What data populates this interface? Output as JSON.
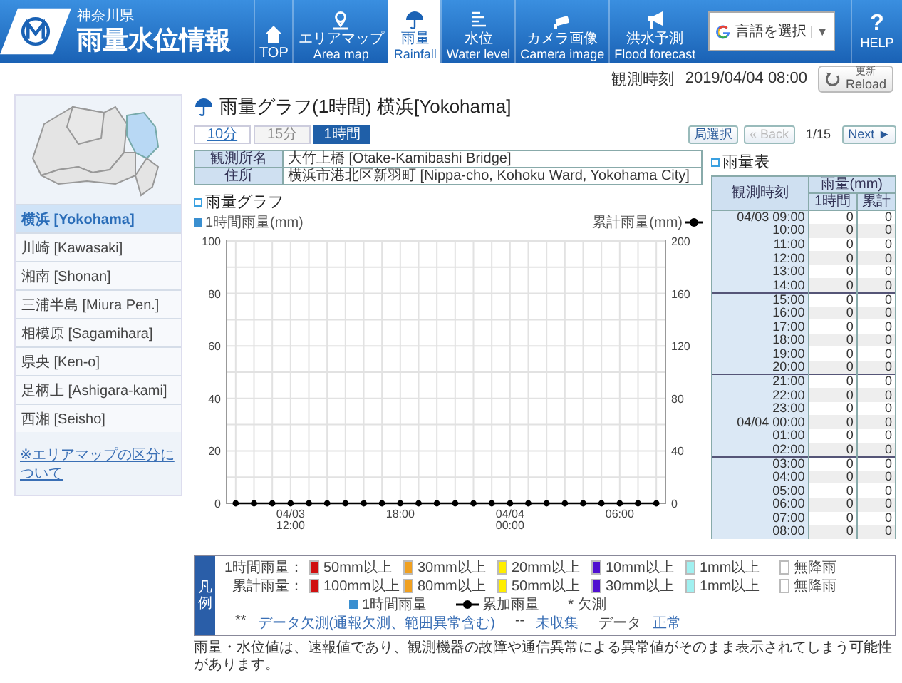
{
  "header": {
    "prefecture": "神奈川県",
    "title": "雨量水位情報",
    "nav": [
      {
        "kind": "home",
        "label": "TOP",
        "selected": false
      },
      {
        "kind": "pin",
        "label": "エリアマップ",
        "sublabel": "Area map",
        "selected": false
      },
      {
        "kind": "umbrella",
        "label": "雨量",
        "sublabel": "Rainfall",
        "selected": true
      },
      {
        "kind": "lines",
        "label": "水位",
        "sublabel": "Water level",
        "selected": false
      },
      {
        "kind": "camera",
        "label": "カメラ画像",
        "sublabel": "Camera image",
        "selected": false
      },
      {
        "kind": "megaphone",
        "label": "洪水予測",
        "sublabel": "Flood forecast",
        "selected": false
      }
    ],
    "language": {
      "label": "言語を選択",
      "caret": "▼"
    },
    "help": {
      "symbol": "?",
      "label": "HELP"
    }
  },
  "observation": {
    "label": "観測時刻",
    "time": "2019/04/04 08:00",
    "reload": {
      "label": "更新",
      "sublabel": "Reload"
    }
  },
  "sidebar": {
    "areas": [
      {
        "label": "横浜 [Yokohama]",
        "selected": true
      },
      {
        "label": "川崎 [Kawasaki]",
        "selected": false
      },
      {
        "label": "湘南 [Shonan]",
        "selected": false
      },
      {
        "label": "三浦半島 [Miura Pen.]",
        "selected": false
      },
      {
        "label": "相模原 [Sagamihara]",
        "selected": false
      },
      {
        "label": "県央 [Ken-o]",
        "selected": false
      },
      {
        "label": "足柄上 [Ashigara-kami]",
        "selected": false
      },
      {
        "label": "西湘 [Seisho]",
        "selected": false
      }
    ],
    "link": "※エリアマップの区分について"
  },
  "page_title": "雨量グラフ(1時間) 横浜[Yokohama]",
  "intervals": [
    {
      "label": "10分",
      "selected": false,
      "disabled": false
    },
    {
      "label": "15分",
      "selected": false,
      "disabled": true
    },
    {
      "label": "1時間",
      "selected": true,
      "disabled": false
    }
  ],
  "pager": {
    "station_select": "局選択",
    "back": {
      "label": "« Back",
      "disabled": true
    },
    "position": "1/15",
    "next": {
      "label": "Next ►",
      "disabled": false
    }
  },
  "station_info": [
    {
      "label": "観測所名",
      "value": "大竹上橋 [Otake-Kamibashi Bridge]"
    },
    {
      "label": "住所",
      "value": "横浜市港北区新羽町 [Nippa-cho, Kohoku Ward, Yokohama City]"
    }
  ],
  "graph": {
    "heading": "雨量グラフ",
    "left_label": "1時間雨量(mm)",
    "right_ticks": [
      "200",
      "160",
      "120",
      "80",
      "40",
      "0"
    ],
    "chart_data": {
      "type": "line",
      "categories": [
        null,
        null,
        null,
        "04/03 12:00",
        null,
        null,
        null,
        null,
        null,
        "18:00",
        null,
        null,
        null,
        null,
        null,
        "04/04 00:00",
        null,
        null,
        null,
        null,
        null,
        "06:00",
        null,
        null
      ],
      "grid": true,
      "series": [
        {
          "name": "累計雨量(mm)",
          "color": "#000000",
          "marker": "circle",
          "values": [
            0,
            0,
            0,
            0,
            0,
            0,
            0,
            0,
            0,
            0,
            0,
            0,
            0,
            0,
            0,
            0,
            0,
            0,
            0,
            0,
            0,
            0,
            0,
            0
          ]
        }
      ],
      "ylim": [
        0,
        100
      ],
      "yticks": [
        0,
        20,
        40,
        60,
        80,
        100
      ]
    }
  },
  "rain_table": {
    "heading": "雨量表",
    "columns": [
      "観測時刻",
      "雨量(mm)",
      "1時間",
      "累計"
    ],
    "rows": [
      {
        "time": "04/03 09:00",
        "hourly": "0",
        "total": "0"
      },
      {
        "time": "10:00",
        "hourly": "0",
        "total": "0"
      },
      {
        "time": "11:00",
        "hourly": "0",
        "total": "0"
      },
      {
        "time": "12:00",
        "hourly": "0",
        "total": "0"
      },
      {
        "time": "13:00",
        "hourly": "0",
        "total": "0"
      },
      {
        "time": "14:00",
        "hourly": "0",
        "total": "0"
      },
      {
        "time": "15:00",
        "hourly": "0",
        "total": "0"
      },
      {
        "time": "16:00",
        "hourly": "0",
        "total": "0"
      },
      {
        "time": "17:00",
        "hourly": "0",
        "total": "0"
      },
      {
        "time": "18:00",
        "hourly": "0",
        "total": "0"
      },
      {
        "time": "19:00",
        "hourly": "0",
        "total": "0"
      },
      {
        "time": "20:00",
        "hourly": "0",
        "total": "0"
      },
      {
        "time": "21:00",
        "hourly": "0",
        "total": "0"
      },
      {
        "time": "22:00",
        "hourly": "0",
        "total": "0"
      },
      {
        "time": "23:00",
        "hourly": "0",
        "total": "0"
      },
      {
        "time": "04/04 00:00",
        "hourly": "0",
        "total": "0"
      },
      {
        "time": "01:00",
        "hourly": "0",
        "total": "0"
      },
      {
        "time": "02:00",
        "hourly": "0",
        "total": "0"
      },
      {
        "time": "03:00",
        "hourly": "0",
        "total": "0"
      },
      {
        "time": "04:00",
        "hourly": "0",
        "total": "0"
      },
      {
        "time": "05:00",
        "hourly": "0",
        "total": "0"
      },
      {
        "time": "06:00",
        "hourly": "0",
        "total": "0"
      },
      {
        "time": "07:00",
        "hourly": "0",
        "total": "0"
      },
      {
        "time": "08:00",
        "hourly": "0",
        "total": "0"
      }
    ]
  },
  "legend": {
    "title": "凡例",
    "rows": [
      {
        "label": "1時間雨量：",
        "items": [
          {
            "label": "50mm以上",
            "color": "#d01010"
          },
          {
            "label": "30mm以上",
            "color": "#f0a020"
          },
          {
            "label": "20mm以上",
            "color": "#ffee00"
          },
          {
            "label": "10mm以上",
            "color": "#5010d0"
          },
          {
            "label": "1mm以上",
            "color": "#a0f0f0"
          },
          {
            "label": "無降雨",
            "color": "#ffffff"
          }
        ]
      },
      {
        "label": "累計雨量：",
        "items": [
          {
            "label": "100mm以上",
            "color": "#d01010"
          },
          {
            "label": "80mm以上",
            "color": "#f0a020"
          },
          {
            "label": "50mm以上",
            "color": "#ffee00"
          },
          {
            "label": "30mm以上",
            "color": "#5010d0"
          },
          {
            "label": "1mm以上",
            "color": "#a0f0f0"
          },
          {
            "label": "無降雨",
            "color": "#ffffff"
          }
        ]
      }
    ],
    "markers": [
      {
        "kind": "square",
        "label": "1時間雨量"
      },
      {
        "kind": "line",
        "label": "累加雨量"
      },
      {
        "kind": "text",
        "symbol": "*",
        "label": "欠測"
      }
    ],
    "codes": [
      {
        "symbol": "**",
        "label": "データ欠測(通報欠測、範囲異常含む)"
      },
      {
        "symbol": "--",
        "label": "未収集"
      },
      {
        "symbol": "データ",
        "label": "正常"
      }
    ]
  },
  "note": "雨量・水位値は、速報値であり、観測機器の故障や通信異常による異常値がそのまま表示されてしまう可能性があります。"
}
